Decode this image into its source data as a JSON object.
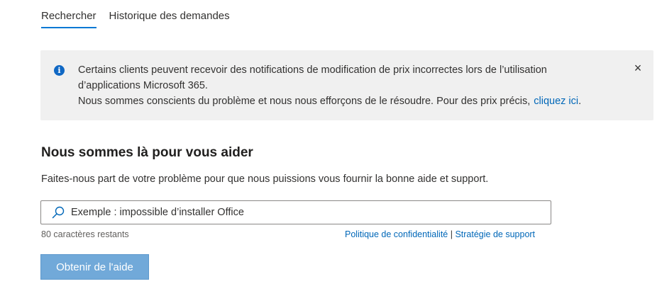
{
  "tabs": [
    {
      "label": "Rechercher",
      "active": true
    },
    {
      "label": "Historique des demandes",
      "active": false
    }
  ],
  "banner": {
    "icon": "info-icon",
    "line1": "Certains clients peuvent recevoir des notifications de modification de prix incorrectes lors de l’utilisation",
    "line2": "d’applications Microsoft 365.",
    "line3": "Nous sommes conscients du problème et nous nous efforçons de le résoudre. Pour des prix précis,",
    "link_label": "cliquez ici",
    "link_suffix": ".",
    "close_icon": "×"
  },
  "heading": "Nous sommes là pour vous aider",
  "subtext": "Faites-nous part de votre problème pour que nous puissions vous fournir la bonne aide et support.",
  "search": {
    "placeholder": "Exemple : impossible d’installer Office",
    "value": ""
  },
  "counter": "80 caractères restants",
  "links": {
    "privacy": "Politique de confidentialité",
    "separator": " | ",
    "support": "Stratégie de support"
  },
  "submit_label": "Obtenir de l'aide",
  "colors": {
    "accent": "#0078d4",
    "link": "#0067b8",
    "banner_bg": "#f0f0f0",
    "button_disabled": "#71a9d9"
  }
}
